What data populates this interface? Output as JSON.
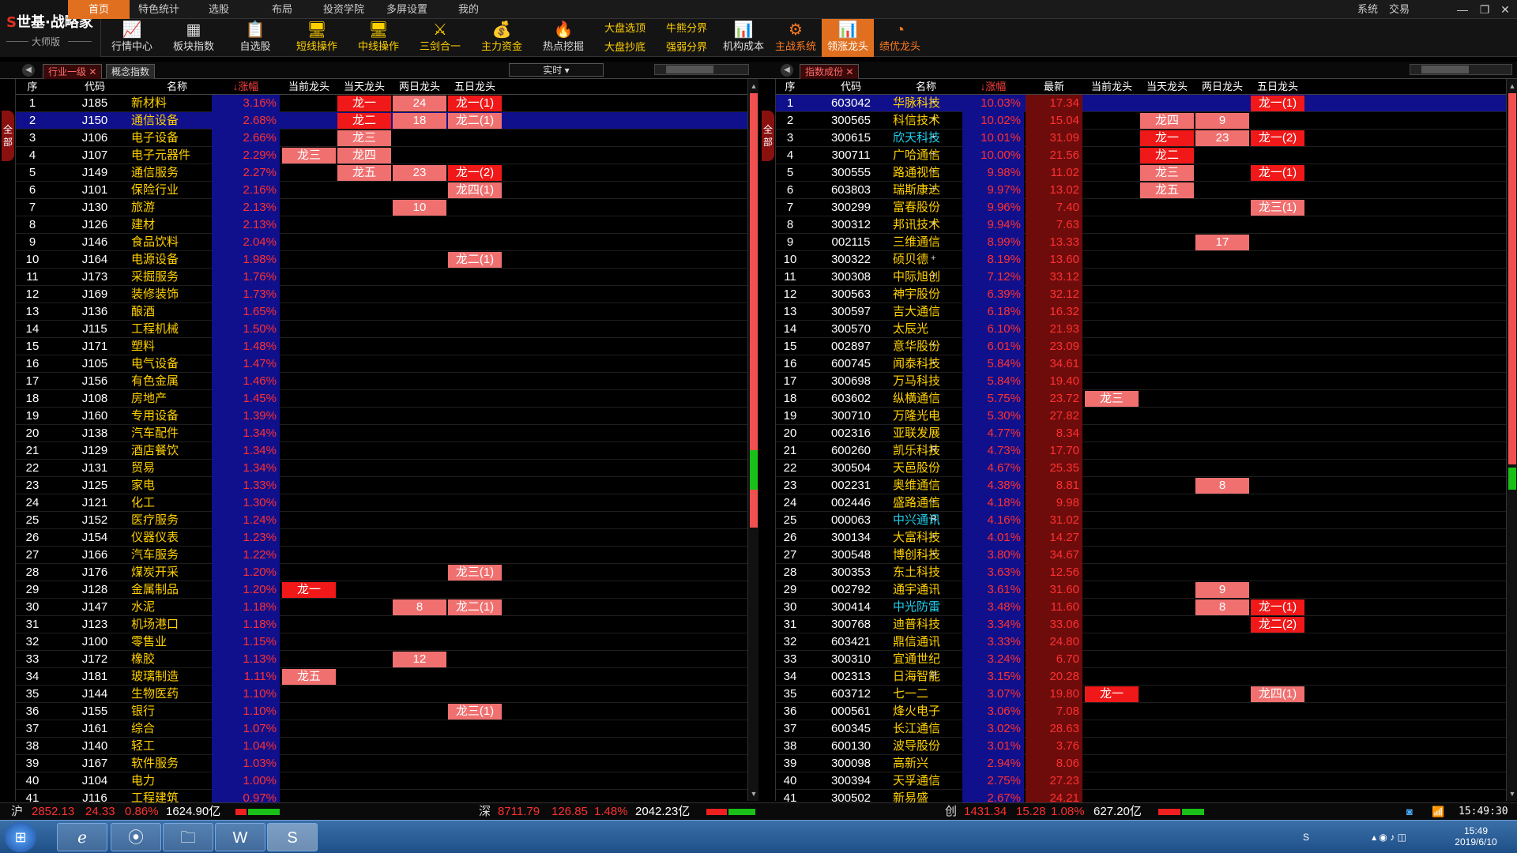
{
  "app": {
    "logo_text": "世基·战略家",
    "logo_mark": "S",
    "edition": "大师版"
  },
  "menu": [
    "首页",
    "特色统计",
    "选股",
    "布局",
    "投资学院",
    "多屏设置",
    "我的"
  ],
  "menu_active": 0,
  "sys_menu": [
    "系统",
    "交易"
  ],
  "toolbar": [
    {
      "label": "行情中心",
      "icon": "📈",
      "style": "w"
    },
    {
      "label": "板块指数",
      "icon": "▦",
      "style": "w"
    },
    {
      "label": "自选股",
      "icon": "📋",
      "style": "w"
    },
    {
      "label": "短线操作",
      "icon": "🖥",
      "style": "y"
    },
    {
      "label": "中线操作",
      "icon": "🖥",
      "style": "y"
    },
    {
      "label": "三剑合一",
      "icon": "⚔",
      "style": "y"
    },
    {
      "label": "主力资金",
      "icon": "💰",
      "style": "y"
    },
    {
      "label": "热点挖掘",
      "icon": "🔥",
      "style": "w"
    }
  ],
  "toolbar_pairs": [
    [
      "大盘选顶",
      "大盘抄底"
    ],
    [
      "牛熊分界",
      "强弱分界"
    ]
  ],
  "toolbar2": [
    {
      "label": "机构成本",
      "icon": "📊",
      "style": "w"
    },
    {
      "label": "主战系统",
      "icon": "⚙",
      "style": "o"
    },
    {
      "label": "领涨龙头",
      "icon": "📊",
      "style": "sel"
    },
    {
      "label": "绩优龙头",
      "icon": "◔",
      "style": "o"
    }
  ],
  "left": {
    "tabs": [
      "行业一级",
      "概念指数"
    ],
    "dropdown": "实时",
    "side_tag": "全部",
    "headers": [
      "序",
      "代码",
      "名称",
      "↓涨幅",
      "当前龙头",
      "当天龙头",
      "两日龙头",
      "五日龙头"
    ],
    "selected_row": 2,
    "rows": [
      [
        "1",
        "J185",
        "新材料",
        "3.16%",
        "",
        "龙一",
        "24",
        "龙一(1)"
      ],
      [
        "2",
        "J150",
        "通信设备",
        "2.68%",
        "",
        "龙二",
        "18",
        "龙二(1)"
      ],
      [
        "3",
        "J106",
        "电子设备",
        "2.66%",
        "",
        "龙三",
        "",
        ""
      ],
      [
        "4",
        "J107",
        "电子元器件",
        "2.29%",
        "龙三",
        "龙四",
        "",
        ""
      ],
      [
        "5",
        "J149",
        "通信服务",
        "2.27%",
        "",
        "龙五",
        "23",
        "龙一(2)"
      ],
      [
        "6",
        "J101",
        "保险行业",
        "2.16%",
        "",
        "",
        "",
        "龙四(1)"
      ],
      [
        "7",
        "J130",
        "旅游",
        "2.13%",
        "",
        "",
        "10",
        ""
      ],
      [
        "8",
        "J126",
        "建材",
        "2.13%",
        "",
        "",
        "",
        ""
      ],
      [
        "9",
        "J146",
        "食品饮料",
        "2.04%",
        "",
        "",
        "",
        ""
      ],
      [
        "10",
        "J164",
        "电源设备",
        "1.98%",
        "",
        "",
        "",
        "龙二(1)"
      ],
      [
        "11",
        "J173",
        "采掘服务",
        "1.76%",
        "",
        "",
        "",
        ""
      ],
      [
        "12",
        "J169",
        "装修装饰",
        "1.73%",
        "",
        "",
        "",
        ""
      ],
      [
        "13",
        "J136",
        "酿酒",
        "1.65%",
        "",
        "",
        "",
        ""
      ],
      [
        "14",
        "J115",
        "工程机械",
        "1.50%",
        "",
        "",
        "",
        ""
      ],
      [
        "15",
        "J171",
        "塑料",
        "1.48%",
        "",
        "",
        "",
        ""
      ],
      [
        "16",
        "J105",
        "电气设备",
        "1.47%",
        "",
        "",
        "",
        ""
      ],
      [
        "17",
        "J156",
        "有色金属",
        "1.46%",
        "",
        "",
        "",
        ""
      ],
      [
        "18",
        "J108",
        "房地产",
        "1.45%",
        "",
        "",
        "",
        ""
      ],
      [
        "19",
        "J160",
        "专用设备",
        "1.39%",
        "",
        "",
        "",
        ""
      ],
      [
        "20",
        "J138",
        "汽车配件",
        "1.34%",
        "",
        "",
        "",
        ""
      ],
      [
        "21",
        "J129",
        "酒店餐饮",
        "1.34%",
        "",
        "",
        "",
        ""
      ],
      [
        "22",
        "J131",
        "贸易",
        "1.34%",
        "",
        "",
        "",
        ""
      ],
      [
        "23",
        "J125",
        "家电",
        "1.33%",
        "",
        "",
        "",
        ""
      ],
      [
        "24",
        "J121",
        "化工",
        "1.30%",
        "",
        "",
        "",
        ""
      ],
      [
        "25",
        "J152",
        "医疗服务",
        "1.24%",
        "",
        "",
        "",
        ""
      ],
      [
        "26",
        "J154",
        "仪器仪表",
        "1.23%",
        "",
        "",
        "",
        ""
      ],
      [
        "27",
        "J166",
        "汽车服务",
        "1.22%",
        "",
        "",
        "",
        ""
      ],
      [
        "28",
        "J176",
        "煤炭开采",
        "1.20%",
        "",
        "",
        "",
        "龙三(1)"
      ],
      [
        "29",
        "J128",
        "金属制品",
        "1.20%",
        "龙一",
        "",
        "",
        ""
      ],
      [
        "30",
        "J147",
        "水泥",
        "1.18%",
        "",
        "",
        "8",
        "龙二(1)"
      ],
      [
        "31",
        "J123",
        "机场港口",
        "1.18%",
        "",
        "",
        "",
        ""
      ],
      [
        "32",
        "J100",
        "零售业",
        "1.15%",
        "",
        "",
        "",
        ""
      ],
      [
        "33",
        "J172",
        "橡胶",
        "1.13%",
        "",
        "",
        "12",
        ""
      ],
      [
        "34",
        "J181",
        "玻璃制造",
        "1.11%",
        "龙五",
        "",
        "",
        ""
      ],
      [
        "35",
        "J144",
        "生物医药",
        "1.10%",
        "",
        "",
        "",
        ""
      ],
      [
        "36",
        "J155",
        "银行",
        "1.10%",
        "",
        "",
        "",
        "龙三(1)"
      ],
      [
        "37",
        "J161",
        "综合",
        "1.07%",
        "",
        "",
        "",
        ""
      ],
      [
        "38",
        "J140",
        "轻工",
        "1.04%",
        "",
        "",
        "",
        ""
      ],
      [
        "39",
        "J167",
        "软件服务",
        "1.03%",
        "",
        "",
        "",
        ""
      ],
      [
        "40",
        "J104",
        "电力",
        "1.00%",
        "",
        "",
        "",
        ""
      ],
      [
        "41",
        "J116",
        "工程建筑",
        "0.97%",
        "",
        "",
        "",
        ""
      ]
    ]
  },
  "right": {
    "tabs": [
      "指数成份"
    ],
    "side_tag": "全部",
    "headers": [
      "序",
      "代码",
      "名称",
      "↓涨幅",
      "最新",
      "当前龙头",
      "当天龙头",
      "两日龙头",
      "五日龙头"
    ],
    "selected_row": 1,
    "rows": [
      [
        "1",
        "603042",
        "华脉科技",
        "+",
        "10.03%",
        "17.34",
        "",
        "",
        "",
        "龙一(1)"
      ],
      [
        "2",
        "300565",
        "科信技术",
        "+",
        "10.02%",
        "15.04",
        "",
        "龙四",
        "9",
        ""
      ],
      [
        "3",
        "300615",
        "欣天科技",
        "+",
        "10.01%",
        "31.09",
        "",
        "龙一",
        "23",
        "龙一(2)"
      ],
      [
        "4",
        "300711",
        "广哈通信",
        "+",
        "10.00%",
        "21.56",
        "",
        "龙二",
        "",
        ""
      ],
      [
        "5",
        "300555",
        "路通视信",
        "+",
        "9.98%",
        "11.02",
        "",
        "龙三",
        "",
        "龙一(1)"
      ],
      [
        "6",
        "603803",
        "瑞斯康达",
        "+",
        "9.97%",
        "13.02",
        "",
        "龙五",
        "",
        ""
      ],
      [
        "7",
        "300299",
        "富春股份",
        "",
        "9.96%",
        "7.40",
        "",
        "",
        "",
        "龙三(1)"
      ],
      [
        "8",
        "300312",
        "邦讯技术",
        "+",
        "9.94%",
        "7.63",
        "",
        "",
        "",
        ""
      ],
      [
        "9",
        "002115",
        "三维通信",
        "",
        "8.99%",
        "13.33",
        "",
        "",
        "17",
        ""
      ],
      [
        "10",
        "300322",
        "硕贝德",
        "+",
        "8.19%",
        "13.60",
        "",
        "",
        "",
        ""
      ],
      [
        "11",
        "300308",
        "中际旭创",
        "+",
        "7.12%",
        "33.12",
        "",
        "",
        "",
        ""
      ],
      [
        "12",
        "300563",
        "神宇股份",
        "",
        "6.39%",
        "32.12",
        "",
        "",
        "",
        ""
      ],
      [
        "13",
        "300597",
        "吉大通信",
        "",
        "6.18%",
        "16.32",
        "",
        "",
        "",
        ""
      ],
      [
        "14",
        "300570",
        "太辰光",
        "",
        "6.10%",
        "21.93",
        "",
        "",
        "",
        ""
      ],
      [
        "15",
        "002897",
        "意华股份",
        "+",
        "6.01%",
        "23.09",
        "",
        "",
        "",
        ""
      ],
      [
        "16",
        "600745",
        "闻泰科技",
        "+",
        "5.84%",
        "34.61",
        "",
        "",
        "",
        ""
      ],
      [
        "17",
        "300698",
        "万马科技",
        "",
        "5.84%",
        "19.40",
        "",
        "",
        "",
        ""
      ],
      [
        "18",
        "603602",
        "纵横通信",
        "",
        "5.75%",
        "23.72",
        "龙三",
        "",
        "",
        ""
      ],
      [
        "19",
        "300710",
        "万隆光电",
        "",
        "5.30%",
        "27.82",
        "",
        "",
        "",
        ""
      ],
      [
        "20",
        "002316",
        "亚联发展",
        "",
        "4.77%",
        "8.34",
        "",
        "",
        "",
        ""
      ],
      [
        "21",
        "600260",
        "凯乐科技",
        "R",
        "4.73%",
        "17.70",
        "",
        "",
        "",
        ""
      ],
      [
        "22",
        "300504",
        "天邑股份",
        "",
        "4.67%",
        "25.35",
        "",
        "",
        "",
        ""
      ],
      [
        "23",
        "002231",
        "奥维通信",
        "",
        "4.38%",
        "8.81",
        "",
        "",
        "8",
        ""
      ],
      [
        "24",
        "002446",
        "盛路通信",
        "+",
        "4.18%",
        "9.98",
        "",
        "",
        "",
        ""
      ],
      [
        "25",
        "000063",
        "中兴通讯",
        "R",
        "4.16%",
        "31.02",
        "",
        "",
        "",
        ""
      ],
      [
        "26",
        "300134",
        "大富科技",
        "+",
        "4.01%",
        "14.27",
        "",
        "",
        "",
        ""
      ],
      [
        "27",
        "300548",
        "博创科技",
        "+",
        "3.80%",
        "34.67",
        "",
        "",
        "",
        ""
      ],
      [
        "28",
        "300353",
        "东土科技",
        "",
        "3.63%",
        "12.56",
        "",
        "",
        "",
        ""
      ],
      [
        "29",
        "002792",
        "通宇通讯",
        "",
        "3.61%",
        "31.60",
        "",
        "",
        "9",
        ""
      ],
      [
        "30",
        "300414",
        "中光防雷",
        "",
        "3.48%",
        "11.60",
        "",
        "",
        "8",
        "龙一(1)"
      ],
      [
        "31",
        "300768",
        "迪普科技",
        "",
        "3.34%",
        "33.06",
        "",
        "",
        "",
        "龙二(2)"
      ],
      [
        "32",
        "603421",
        "鼎信通讯",
        "",
        "3.33%",
        "24.80",
        "",
        "",
        "",
        ""
      ],
      [
        "33",
        "300310",
        "宜通世纪",
        "",
        "3.24%",
        "6.70",
        "",
        "",
        "",
        ""
      ],
      [
        "34",
        "002313",
        "日海智能",
        "R",
        "3.15%",
        "20.28",
        "",
        "",
        "",
        ""
      ],
      [
        "35",
        "603712",
        "七一二",
        "",
        "3.07%",
        "19.80",
        "龙一",
        "",
        "",
        "龙四(1)"
      ],
      [
        "36",
        "000561",
        "烽火电子",
        "",
        "3.06%",
        "7.08",
        "",
        "",
        "",
        ""
      ],
      [
        "37",
        "600345",
        "长江通信",
        "",
        "3.02%",
        "28.63",
        "",
        "",
        "",
        ""
      ],
      [
        "38",
        "600130",
        "波导股份",
        "",
        "3.01%",
        "3.76",
        "",
        "",
        "",
        ""
      ],
      [
        "39",
        "300098",
        "高新兴",
        "",
        "2.94%",
        "8.06",
        "",
        "",
        "",
        ""
      ],
      [
        "40",
        "300394",
        "天孚通信",
        "",
        "2.75%",
        "27.23",
        "",
        "",
        "",
        ""
      ],
      [
        "41",
        "300502",
        "新易盛",
        "",
        "2.67%",
        "24.21",
        "",
        "",
        "",
        ""
      ]
    ]
  },
  "cyan_names": [
    "欣天科技",
    "中兴通讯",
    "中光防雷"
  ],
  "light_badges": [
    "24",
    "18",
    "23",
    "10",
    "龙三",
    "龙四",
    "龙五",
    "龙二(1)",
    "龙四(1)",
    "龙三(1)",
    "8",
    "12",
    "9",
    "17"
  ],
  "status": {
    "sh": {
      "label": "沪",
      "index": "2852.13",
      "chg": "24.33",
      "pct": "0.86%",
      "amt": "1624.90亿"
    },
    "sz": {
      "label": "深",
      "index": "8711.79",
      "chg": "126.85",
      "pct": "1.48%",
      "amt": "2042.23亿"
    },
    "cy": {
      "label": "创",
      "index": "1431.34",
      "chg": "15.28",
      "pct": "1.08%",
      "amt": "627.20亿"
    },
    "time": "15:49:30"
  },
  "taskbar": {
    "clock": "15:49",
    "date": "2019/6/10"
  },
  "colors": {
    "accent": "#e07020",
    "up": "#ff3030",
    "name": "#ffd000",
    "badge_dark": "#f01818",
    "badge_light": "#f07070",
    "selected": "#10108c"
  }
}
